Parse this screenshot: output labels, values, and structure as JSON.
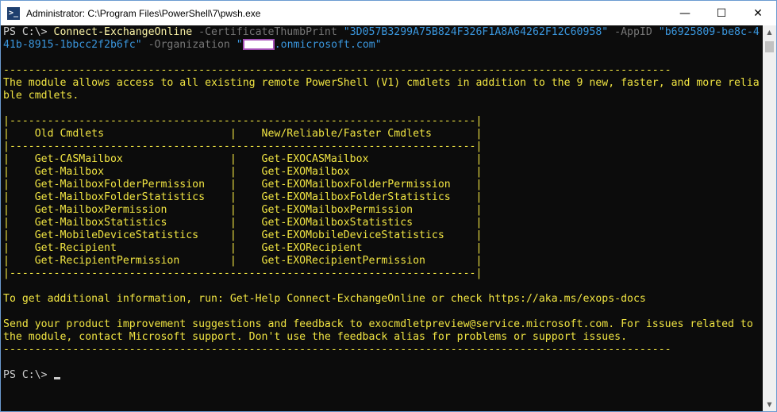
{
  "window": {
    "title": "Administrator: C:\\Program Files\\PowerShell\\7\\pwsh.exe",
    "app_icon_glyph": ">_",
    "controls": {
      "minimize": "—",
      "maximize": "☐",
      "close": "✕"
    }
  },
  "terminal": {
    "prompt": "PS C:\\> ",
    "command": {
      "cmdlet": "Connect-ExchangeOnline",
      "param1": " -CertificateThumbPrint ",
      "value1": "\"3D057B3299A75B824F326F1A8A64262F12C60958\"",
      "param2": " -AppID ",
      "value2_part1": "\"b6925809-be8c-4",
      "value2_part2": "41b-8915-1bbcc2f2b6fc\"",
      "param3": " -Organization ",
      "value3_open": "\"",
      "value3_rest": ".onmicrosoft.com\""
    },
    "separator": "----------------------------------------------------------------------------------------------------------",
    "intro_line1": "The module allows access to all existing remote PowerShell (V1) cmdlets in addition to the 9 new, faster, and more relia",
    "intro_line2": "ble cmdlets.",
    "table": {
      "border_top": "|--------------------------------------------------------------------------|",
      "header": "|    Old Cmdlets                    |    New/Reliable/Faster Cmdlets       |",
      "border_mid": "|--------------------------------------------------------------------------|",
      "rows": [
        "|    Get-CASMailbox                 |    Get-EXOCASMailbox                 |",
        "|    Get-Mailbox                    |    Get-EXOMailbox                    |",
        "|    Get-MailboxFolderPermission    |    Get-EXOMailboxFolderPermission    |",
        "|    Get-MailboxFolderStatistics    |    Get-EXOMailboxFolderStatistics    |",
        "|    Get-MailboxPermission          |    Get-EXOMailboxPermission          |",
        "|    Get-MailboxStatistics          |    Get-EXOMailboxStatistics          |",
        "|    Get-MobileDeviceStatistics     |    Get-EXOMobileDeviceStatistics     |",
        "|    Get-Recipient                  |    Get-EXORecipient                  |",
        "|    Get-RecipientPermission        |    Get-EXORecipientPermission        |"
      ],
      "border_bottom": "|--------------------------------------------------------------------------|"
    },
    "help_line": "To get additional information, run: Get-Help Connect-ExchangeOnline or check https://aka.ms/exops-docs",
    "feedback_line1": "Send your product improvement suggestions and feedback to exocmdletpreview@service.microsoft.com. For issues related to",
    "feedback_line2": "the module, contact Microsoft support. Don't use the feedback alias for problems or support issues.",
    "separator2": "----------------------------------------------------------------------------------------------------------",
    "final_prompt": "PS C:\\> "
  },
  "scrollbar": {
    "up": "▲",
    "down": "▼"
  },
  "colors": {
    "background": "#0c0c0c",
    "default_text": "#cccccc",
    "cmdlet": "#f9f1a5",
    "parameter": "#767676",
    "string": "#3a96dd",
    "output": "#f0e442",
    "redaction_border": "#a44fb6"
  }
}
